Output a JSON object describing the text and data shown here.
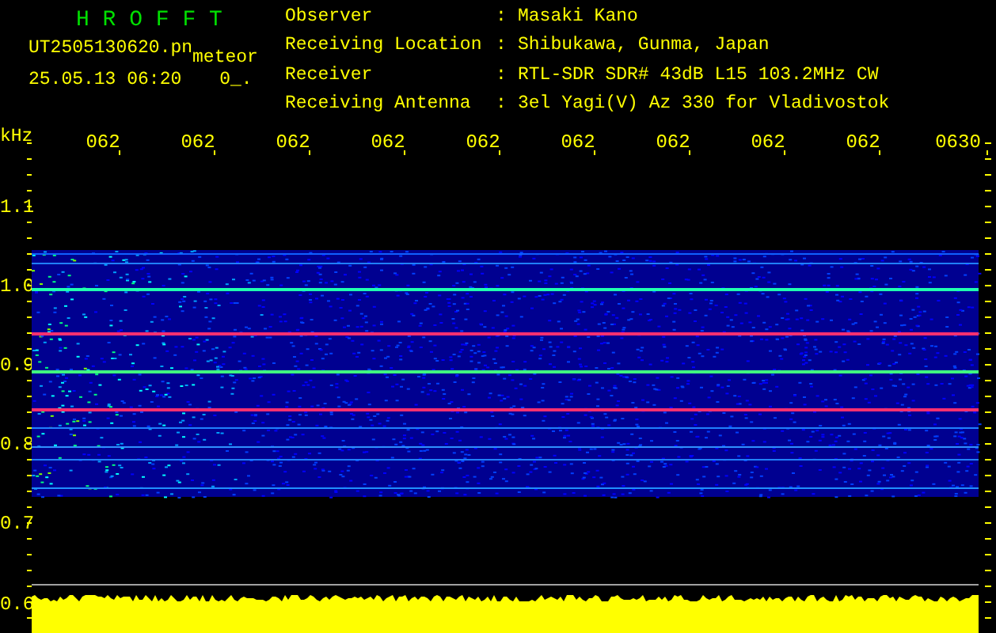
{
  "app_title": "H R O F F T",
  "file_name": "UT2505130620.pn",
  "mode": "meteor",
  "timestamp": "25.05.13 06:20",
  "status_code": "0_.",
  "info": [
    {
      "label": "Observer",
      "separator": ":",
      "value": "Masaki Kano"
    },
    {
      "label": "Receiving Location",
      "separator": ":",
      "value": "Shibukawa, Gunma, Japan"
    },
    {
      "label": "Receiver",
      "separator": ":",
      "value": "RTL-SDR SDR# 43dB L15 103.2MHz CW"
    },
    {
      "label": "Receiving Antenna",
      "separator": ":",
      "value": "3el Yagi(V) Az 330 for Vladivostok"
    }
  ],
  "axis_unit": "kHz",
  "time_labels": [
    "062",
    "062",
    "062",
    "062",
    "062",
    "062",
    "062",
    "062",
    "062",
    "0630"
  ],
  "frequency_labels": [
    "1.1",
    "1.0",
    "0.9",
    "0.8",
    "0.7",
    "0.6"
  ]
}
